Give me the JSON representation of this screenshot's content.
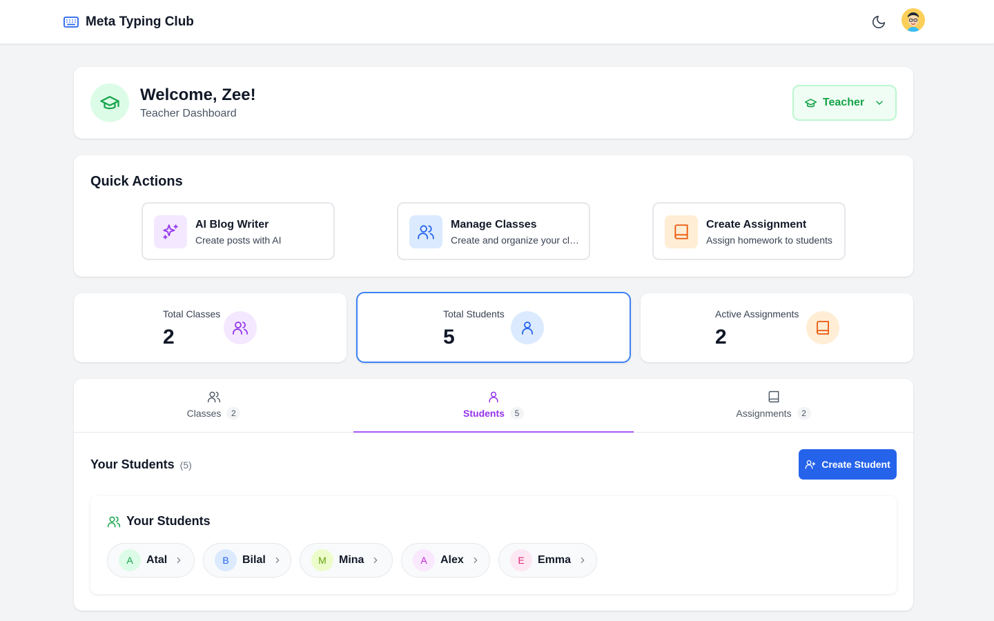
{
  "brand": {
    "name": "Meta Typing Club",
    "icon": "keyboard-icon"
  },
  "header": {
    "theme_icon": "moon-icon",
    "avatar_icon": "user-avatar"
  },
  "welcome": {
    "title": "Welcome, Zee!",
    "subtitle": "Teacher Dashboard",
    "role_label": "Teacher",
    "icon": "graduation-cap-icon"
  },
  "quick_actions": {
    "title": "Quick Actions",
    "items": [
      {
        "name": "AI Blog Writer",
        "desc": "Create posts with AI",
        "icon": "sparkles-icon",
        "color": "#9333ea",
        "bg": "#f3e8ff"
      },
      {
        "name": "Manage Classes",
        "desc": "Create and organize your classes",
        "icon": "users-icon",
        "color": "#2563eb",
        "bg": "#dbeafe"
      },
      {
        "name": "Create Assignment",
        "desc": "Assign homework to students",
        "icon": "book-icon",
        "color": "#ea580c",
        "bg": "#ffedd5"
      }
    ]
  },
  "stats": [
    {
      "label": "Total Classes",
      "value": "2",
      "icon": "users-icon",
      "color": "#9333ea",
      "bg": "#f3e8ff"
    },
    {
      "label": "Total Students",
      "value": "5",
      "icon": "user-icon",
      "color": "#2563eb",
      "bg": "#dbeafe"
    },
    {
      "label": "Active Assignments",
      "value": "2",
      "icon": "book-icon",
      "color": "#ea580c",
      "bg": "#ffedd5"
    }
  ],
  "tabs": [
    {
      "label": "Classes",
      "count": "2",
      "icon": "users-icon"
    },
    {
      "label": "Students",
      "count": "5",
      "icon": "user-icon",
      "active": true
    },
    {
      "label": "Assignments",
      "count": "2",
      "icon": "book-icon"
    }
  ],
  "students_section": {
    "title": "Your Students",
    "count": "(5)",
    "create_button": "Create Student",
    "box_title": "Your Students",
    "students": [
      {
        "initial": "A",
        "name": "Atal",
        "color": "#16a34a",
        "bg": "#dcfce7"
      },
      {
        "initial": "B",
        "name": "Bilal",
        "color": "#2563eb",
        "bg": "#dbeafe"
      },
      {
        "initial": "M",
        "name": "Mina",
        "color": "#65a30d",
        "bg": "#ecfccb"
      },
      {
        "initial": "A",
        "name": "Alex",
        "color": "#c026d3",
        "bg": "#fae8ff"
      },
      {
        "initial": "E",
        "name": "Emma",
        "color": "#db2777",
        "bg": "#fce7f3"
      }
    ]
  },
  "colors": {
    "accent_purple": "#9333ea",
    "primary_blue": "#2563eb",
    "success_green": "#16a34a"
  }
}
